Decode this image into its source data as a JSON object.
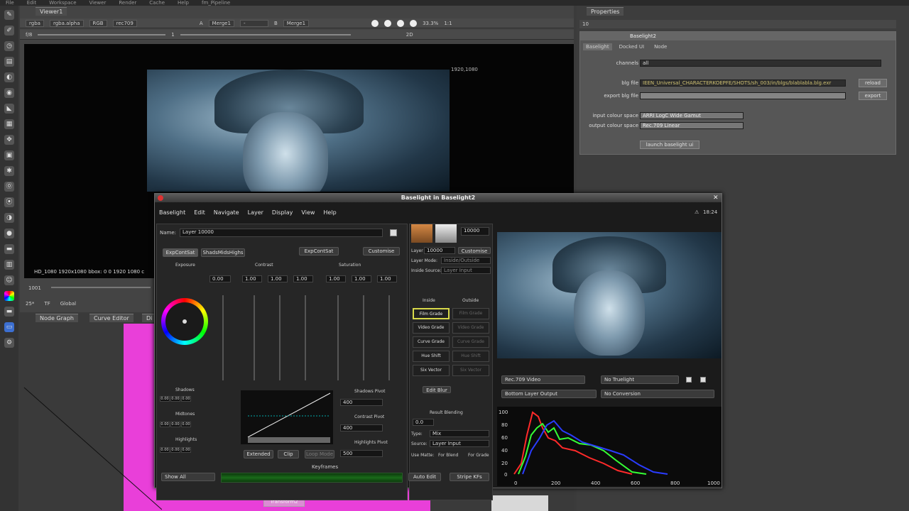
{
  "top_menu": [
    "File",
    "Edit",
    "Workspace",
    "Viewer",
    "Render",
    "Cache",
    "Help",
    "fm_Pipeline"
  ],
  "viewer": {
    "tab": "Viewer1",
    "channels": "rgba",
    "alpha": "rgba.alpha",
    "colorspace": "RGB",
    "lut": "rec709",
    "input_a": "A",
    "input_a_node": "Merge1",
    "input_b": "B",
    "input_b_node": "Merge1",
    "zoom": "33.3%",
    "ratio": "1:1",
    "frame": "f/8",
    "mode": "2D",
    "gain": "1",
    "format_label": "1920,1080",
    "status": "HD_1080 1920x1080  bbox: 0 0 1920 1080  c",
    "frame_num": "1001",
    "fps": "25*",
    "tf": "TF",
    "global": "Global"
  },
  "tabs_bottom": [
    "Node Graph",
    "Curve Editor",
    "Di"
  ],
  "node_transform": "Transform2",
  "properties": {
    "tab": "Properties",
    "count": "10",
    "node_name": "Baselight2",
    "tabs": [
      "Baselight",
      "Docked UI",
      "Node"
    ],
    "channels_label": "channels",
    "channels_value": "all",
    "blg_file_label": "blg file",
    "blg_file_value": "IEEN_Universal_CHARACTERKOEPFE/SHOTS/sh_003/in/blgs/blablabla.blg.exr",
    "reload": "reload",
    "export_label": "export blg file",
    "export": "export",
    "input_cs_label": "input colour space",
    "input_cs": "ARRI LogC Wide Gamut",
    "output_cs_label": "output colour space",
    "output_cs": "Rec.709 Linear",
    "launch": "launch baselight ui"
  },
  "baselight": {
    "title": "Baselight in Baselight2",
    "menu": [
      "Baselight",
      "Edit",
      "Navigate",
      "Layer",
      "Display",
      "View",
      "Help"
    ],
    "clock": "18:24",
    "name_label": "Name:",
    "name_value": "Layer 10000",
    "tabs": [
      "ExpContSat",
      "ShadsMidsHighs"
    ],
    "active_tab": "ExpContSat",
    "customise": "Customise",
    "exposure": "Exposure",
    "contrast": "Contrast",
    "saturation": "Saturation",
    "exp_val": "0.00",
    "con_vals": [
      "1.00",
      "1.00",
      "1.00"
    ],
    "sat_vals": [
      "1.00",
      "1.00",
      "1.00"
    ],
    "shadows": "Shadows",
    "midtones": "Midtones",
    "highlights": "Highlights",
    "shadows_pivot": "Shadows Pivot",
    "contrast_pivot": "Contrast Pivot",
    "highlights_pivot": "Highlights Pivot",
    "pivot_vals": [
      "400",
      "400",
      "500"
    ],
    "triple_zero": [
      "0.00",
      "0.00",
      "0.00"
    ],
    "extended": "Extended",
    "clip": "Clip",
    "loop_mode": "Loop Mode",
    "layer_label": "Layer",
    "layer_num": "10000",
    "layer_box": "10000",
    "customise2": "Customise",
    "layer_mode_label": "Layer Mode:",
    "layer_mode": "Inside/Outside",
    "inside_source_label": "Inside Source:",
    "inside_source": "Layer Input",
    "inside": "Inside",
    "outside": "Outside",
    "grades": [
      "Film Grade",
      "Video Grade",
      "Curve Grade",
      "Hue Shift",
      "Six Vector"
    ],
    "edit_blur": "Edit Blur",
    "result_blending": "Result Blending",
    "blend_val": "0.0",
    "type_label": "Type:",
    "type_val": "Mix",
    "source_label": "Source:",
    "source_val": "Layer Input",
    "use_matte": "Use Matte:",
    "for_blend": "For Blend",
    "for_grade": "For Grade",
    "keyframes": "Keyframes",
    "show_all": "Show All",
    "auto_edit": "Auto Edit",
    "stripe_kfs": "Stripe KFs",
    "view_lut": "Rec.709 Video",
    "truelight": "No Truelight",
    "bottom_layer": "Bottom Layer Output",
    "no_conversion": "No Conversion"
  },
  "histogram": {
    "y_ticks": [
      "100",
      "80",
      "60",
      "40",
      "20",
      "0"
    ],
    "x_ticks": [
      "0",
      "200",
      "400",
      "600",
      "800",
      "1000"
    ],
    "series_colors": {
      "red": "#ff2a2a",
      "green": "#35ff35",
      "blue": "#2a3cff"
    }
  }
}
